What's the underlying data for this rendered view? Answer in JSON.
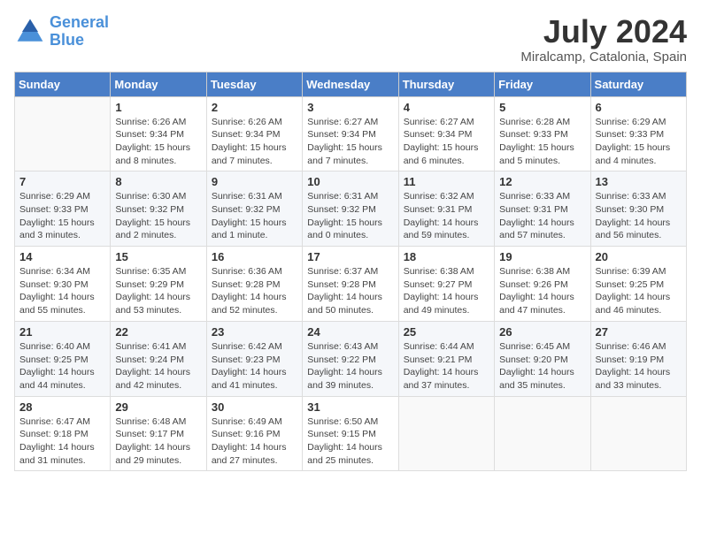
{
  "header": {
    "logo_line1": "General",
    "logo_line2": "Blue",
    "month_year": "July 2024",
    "location": "Miralcamp, Catalonia, Spain"
  },
  "weekdays": [
    "Sunday",
    "Monday",
    "Tuesday",
    "Wednesday",
    "Thursday",
    "Friday",
    "Saturday"
  ],
  "weeks": [
    [
      {
        "day": "",
        "info": ""
      },
      {
        "day": "1",
        "info": "Sunrise: 6:26 AM\nSunset: 9:34 PM\nDaylight: 15 hours\nand 8 minutes."
      },
      {
        "day": "2",
        "info": "Sunrise: 6:26 AM\nSunset: 9:34 PM\nDaylight: 15 hours\nand 7 minutes."
      },
      {
        "day": "3",
        "info": "Sunrise: 6:27 AM\nSunset: 9:34 PM\nDaylight: 15 hours\nand 7 minutes."
      },
      {
        "day": "4",
        "info": "Sunrise: 6:27 AM\nSunset: 9:34 PM\nDaylight: 15 hours\nand 6 minutes."
      },
      {
        "day": "5",
        "info": "Sunrise: 6:28 AM\nSunset: 9:33 PM\nDaylight: 15 hours\nand 5 minutes."
      },
      {
        "day": "6",
        "info": "Sunrise: 6:29 AM\nSunset: 9:33 PM\nDaylight: 15 hours\nand 4 minutes."
      }
    ],
    [
      {
        "day": "7",
        "info": "Sunrise: 6:29 AM\nSunset: 9:33 PM\nDaylight: 15 hours\nand 3 minutes."
      },
      {
        "day": "8",
        "info": "Sunrise: 6:30 AM\nSunset: 9:32 PM\nDaylight: 15 hours\nand 2 minutes."
      },
      {
        "day": "9",
        "info": "Sunrise: 6:31 AM\nSunset: 9:32 PM\nDaylight: 15 hours\nand 1 minute."
      },
      {
        "day": "10",
        "info": "Sunrise: 6:31 AM\nSunset: 9:32 PM\nDaylight: 15 hours\nand 0 minutes."
      },
      {
        "day": "11",
        "info": "Sunrise: 6:32 AM\nSunset: 9:31 PM\nDaylight: 14 hours\nand 59 minutes."
      },
      {
        "day": "12",
        "info": "Sunrise: 6:33 AM\nSunset: 9:31 PM\nDaylight: 14 hours\nand 57 minutes."
      },
      {
        "day": "13",
        "info": "Sunrise: 6:33 AM\nSunset: 9:30 PM\nDaylight: 14 hours\nand 56 minutes."
      }
    ],
    [
      {
        "day": "14",
        "info": "Sunrise: 6:34 AM\nSunset: 9:30 PM\nDaylight: 14 hours\nand 55 minutes."
      },
      {
        "day": "15",
        "info": "Sunrise: 6:35 AM\nSunset: 9:29 PM\nDaylight: 14 hours\nand 53 minutes."
      },
      {
        "day": "16",
        "info": "Sunrise: 6:36 AM\nSunset: 9:28 PM\nDaylight: 14 hours\nand 52 minutes."
      },
      {
        "day": "17",
        "info": "Sunrise: 6:37 AM\nSunset: 9:28 PM\nDaylight: 14 hours\nand 50 minutes."
      },
      {
        "day": "18",
        "info": "Sunrise: 6:38 AM\nSunset: 9:27 PM\nDaylight: 14 hours\nand 49 minutes."
      },
      {
        "day": "19",
        "info": "Sunrise: 6:38 AM\nSunset: 9:26 PM\nDaylight: 14 hours\nand 47 minutes."
      },
      {
        "day": "20",
        "info": "Sunrise: 6:39 AM\nSunset: 9:25 PM\nDaylight: 14 hours\nand 46 minutes."
      }
    ],
    [
      {
        "day": "21",
        "info": "Sunrise: 6:40 AM\nSunset: 9:25 PM\nDaylight: 14 hours\nand 44 minutes."
      },
      {
        "day": "22",
        "info": "Sunrise: 6:41 AM\nSunset: 9:24 PM\nDaylight: 14 hours\nand 42 minutes."
      },
      {
        "day": "23",
        "info": "Sunrise: 6:42 AM\nSunset: 9:23 PM\nDaylight: 14 hours\nand 41 minutes."
      },
      {
        "day": "24",
        "info": "Sunrise: 6:43 AM\nSunset: 9:22 PM\nDaylight: 14 hours\nand 39 minutes."
      },
      {
        "day": "25",
        "info": "Sunrise: 6:44 AM\nSunset: 9:21 PM\nDaylight: 14 hours\nand 37 minutes."
      },
      {
        "day": "26",
        "info": "Sunrise: 6:45 AM\nSunset: 9:20 PM\nDaylight: 14 hours\nand 35 minutes."
      },
      {
        "day": "27",
        "info": "Sunrise: 6:46 AM\nSunset: 9:19 PM\nDaylight: 14 hours\nand 33 minutes."
      }
    ],
    [
      {
        "day": "28",
        "info": "Sunrise: 6:47 AM\nSunset: 9:18 PM\nDaylight: 14 hours\nand 31 minutes."
      },
      {
        "day": "29",
        "info": "Sunrise: 6:48 AM\nSunset: 9:17 PM\nDaylight: 14 hours\nand 29 minutes."
      },
      {
        "day": "30",
        "info": "Sunrise: 6:49 AM\nSunset: 9:16 PM\nDaylight: 14 hours\nand 27 minutes."
      },
      {
        "day": "31",
        "info": "Sunrise: 6:50 AM\nSunset: 9:15 PM\nDaylight: 14 hours\nand 25 minutes."
      },
      {
        "day": "",
        "info": ""
      },
      {
        "day": "",
        "info": ""
      },
      {
        "day": "",
        "info": ""
      }
    ]
  ]
}
